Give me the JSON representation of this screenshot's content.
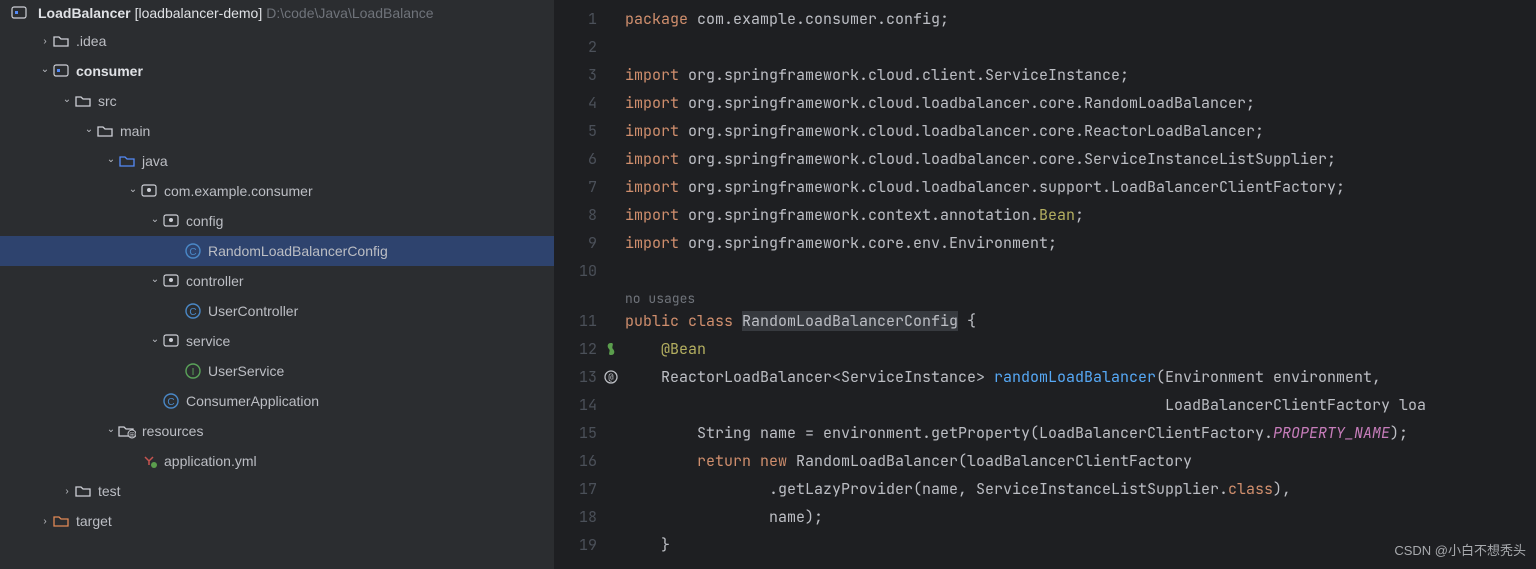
{
  "project": {
    "name": "LoadBalancer",
    "alias": "[loadbalancer-demo]",
    "path": "D:\\code\\Java\\LoadBalance"
  },
  "tree": [
    {
      "indent": 1,
      "chev": ">",
      "icon": "folder",
      "label": ".idea"
    },
    {
      "indent": 1,
      "chev": "v",
      "icon": "module",
      "label": "consumer",
      "bold": true
    },
    {
      "indent": 2,
      "chev": "v",
      "icon": "folder",
      "label": "src"
    },
    {
      "indent": 3,
      "chev": "v",
      "icon": "folder",
      "label": "main"
    },
    {
      "indent": 4,
      "chev": "v",
      "icon": "folder-src",
      "label": "java"
    },
    {
      "indent": 5,
      "chev": "v",
      "icon": "package",
      "label": "com.example.consumer"
    },
    {
      "indent": 6,
      "chev": "v",
      "icon": "package",
      "label": "config"
    },
    {
      "indent": 7,
      "chev": "",
      "icon": "class",
      "label": "RandomLoadBalancerConfig",
      "selected": true
    },
    {
      "indent": 6,
      "chev": "v",
      "icon": "package",
      "label": "controller"
    },
    {
      "indent": 7,
      "chev": "",
      "icon": "class",
      "label": "UserController"
    },
    {
      "indent": 6,
      "chev": "v",
      "icon": "package",
      "label": "service"
    },
    {
      "indent": 7,
      "chev": "",
      "icon": "interface",
      "label": "UserService"
    },
    {
      "indent": 6,
      "chev": "",
      "icon": "class",
      "label": "ConsumerApplication"
    },
    {
      "indent": 4,
      "chev": "v",
      "icon": "folder-res",
      "label": "resources"
    },
    {
      "indent": 5,
      "chev": "",
      "icon": "yaml",
      "label": "application.yml"
    },
    {
      "indent": 2,
      "chev": ">",
      "icon": "folder",
      "label": "test"
    },
    {
      "indent": 1,
      "chev": ">",
      "icon": "folder-target",
      "label": "target"
    }
  ],
  "code": {
    "hint": "no usages",
    "lines": [
      {
        "n": 1,
        "tokens": [
          {
            "t": "package ",
            "c": "kw"
          },
          {
            "t": "com.example.consumer.config;",
            "c": "pkg"
          }
        ]
      },
      {
        "n": 2,
        "tokens": []
      },
      {
        "n": 3,
        "tokens": [
          {
            "t": "import ",
            "c": "kw"
          },
          {
            "t": "org.springframework.cloud.client.ServiceInstance;",
            "c": "pkg"
          }
        ]
      },
      {
        "n": 4,
        "tokens": [
          {
            "t": "import ",
            "c": "kw"
          },
          {
            "t": "org.springframework.cloud.loadbalancer.core.RandomLoadBalancer;",
            "c": "pkg"
          }
        ]
      },
      {
        "n": 5,
        "tokens": [
          {
            "t": "import ",
            "c": "kw"
          },
          {
            "t": "org.springframework.cloud.loadbalancer.core.ReactorLoadBalancer;",
            "c": "pkg"
          }
        ]
      },
      {
        "n": 6,
        "tokens": [
          {
            "t": "import ",
            "c": "kw"
          },
          {
            "t": "org.springframework.cloud.loadbalancer.core.ServiceInstanceListSupplier;",
            "c": "pkg"
          }
        ]
      },
      {
        "n": 7,
        "tokens": [
          {
            "t": "import ",
            "c": "kw"
          },
          {
            "t": "org.springframework.cloud.loadbalancer.support.LoadBalancerClientFactory;",
            "c": "pkg"
          }
        ]
      },
      {
        "n": 8,
        "tokens": [
          {
            "t": "import ",
            "c": "kw"
          },
          {
            "t": "org.springframework.context.annotation.",
            "c": "pkg"
          },
          {
            "t": "Bean",
            "c": "ann"
          },
          {
            "t": ";",
            "c": "pkg"
          }
        ]
      },
      {
        "n": 9,
        "tokens": [
          {
            "t": "import ",
            "c": "kw"
          },
          {
            "t": "org.springframework.core.env.Environment;",
            "c": "pkg"
          }
        ]
      },
      {
        "n": 10,
        "tokens": []
      },
      {
        "n": 11,
        "hint": true,
        "tokens": [
          {
            "t": "public class ",
            "c": "kw"
          },
          {
            "t": "RandomLoadBalancerConfig",
            "c": "cls",
            "hl": true
          },
          {
            "t": " {",
            "c": "txt"
          }
        ]
      },
      {
        "n": 12,
        "gmark": "bean",
        "tokens": [
          {
            "t": "    ",
            "c": "txt"
          },
          {
            "t": "@Bean",
            "c": "ann"
          }
        ]
      },
      {
        "n": 13,
        "gmark": "at",
        "tokens": [
          {
            "t": "    ReactorLoadBalancer<ServiceInstance> ",
            "c": "txt"
          },
          {
            "t": "randomLoadBalancer",
            "c": "mname"
          },
          {
            "t": "(Environment environment,",
            "c": "txt"
          }
        ]
      },
      {
        "n": 14,
        "tokens": [
          {
            "t": "                                                            LoadBalancerClientFactory loa",
            "c": "txt"
          }
        ]
      },
      {
        "n": 15,
        "tokens": [
          {
            "t": "        String name = environment.getProperty(LoadBalancerClientFactory.",
            "c": "txt"
          },
          {
            "t": "PROPERTY_NAME",
            "c": "field"
          },
          {
            "t": ");",
            "c": "txt"
          }
        ]
      },
      {
        "n": 16,
        "tokens": [
          {
            "t": "        ",
            "c": "txt"
          },
          {
            "t": "return new ",
            "c": "kw"
          },
          {
            "t": "RandomLoadBalancer(loadBalancerClientFactory",
            "c": "txt"
          }
        ]
      },
      {
        "n": 17,
        "tokens": [
          {
            "t": "                .getLazyProvider(name, ServiceInstanceListSupplier.",
            "c": "txt"
          },
          {
            "t": "class",
            "c": "kw"
          },
          {
            "t": "),",
            "c": "txt"
          }
        ]
      },
      {
        "n": 18,
        "tokens": [
          {
            "t": "                name);",
            "c": "txt"
          }
        ]
      },
      {
        "n": 19,
        "tokens": [
          {
            "t": "    }",
            "c": "txt"
          }
        ]
      }
    ]
  },
  "watermark": "CSDN @小白不想秃头"
}
